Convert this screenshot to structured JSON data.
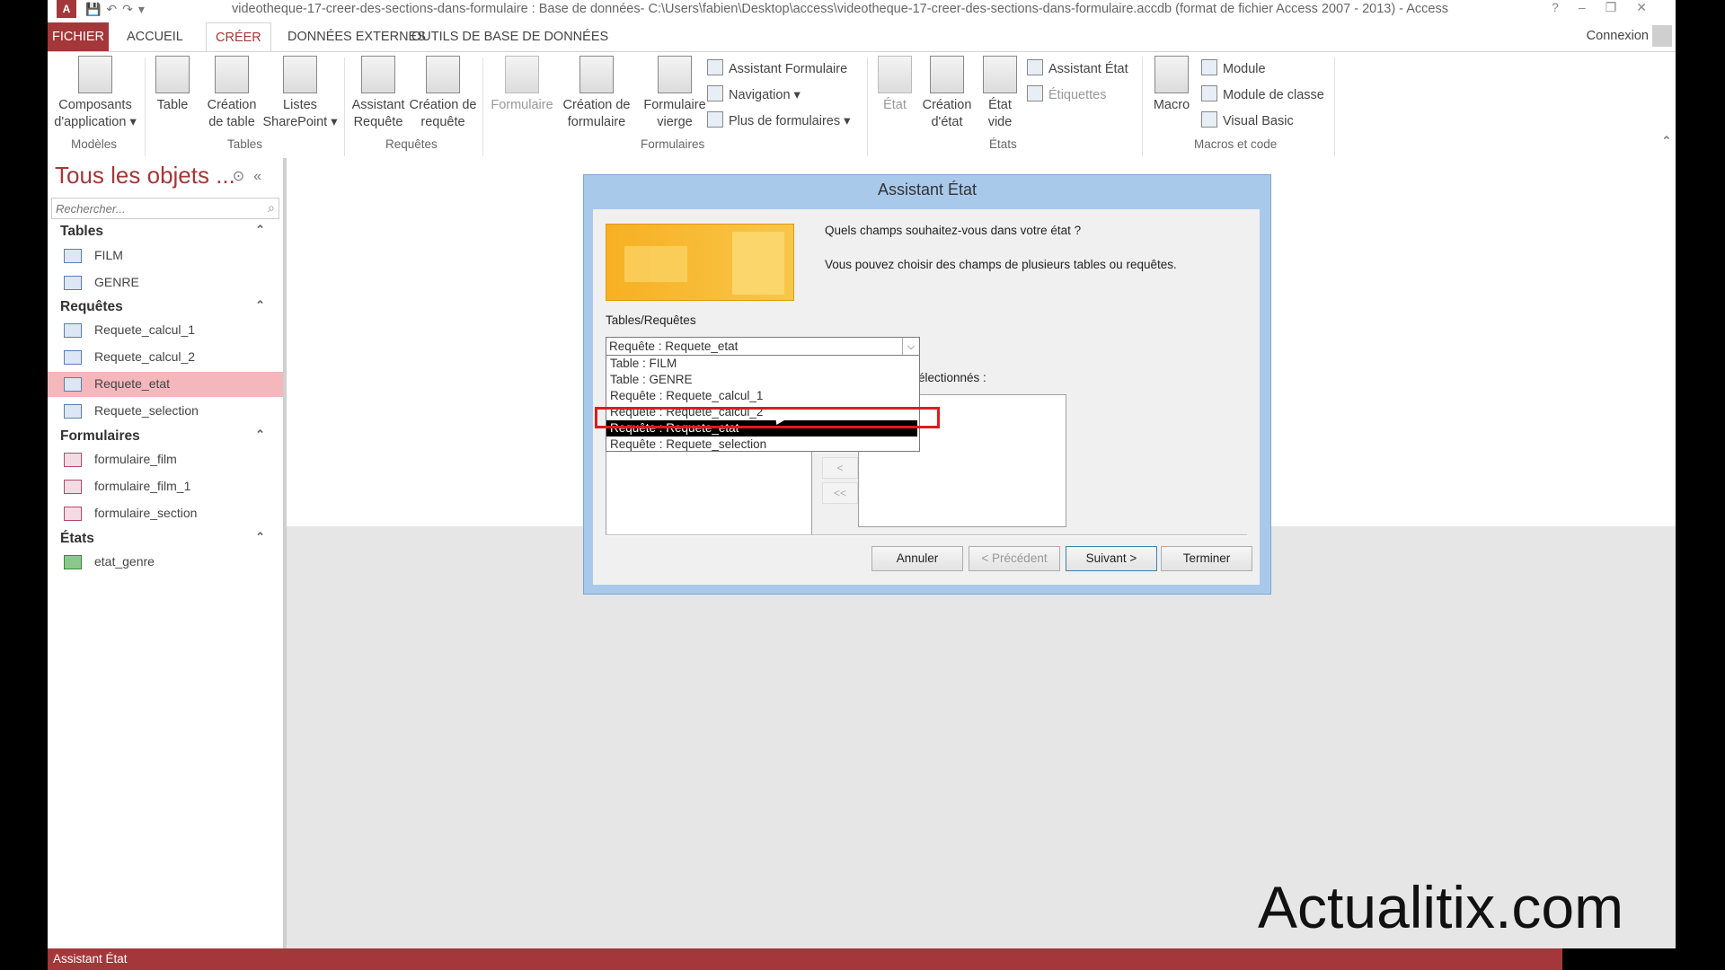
{
  "window": {
    "app_logo": "A",
    "title": "videotheque-17-creer-des-sections-dans-formulaire : Base de données- C:\\Users\\fabien\\Desktop\\access\\videotheque-17-creer-des-sections-dans-formulaire.accdb (format de fichier Access 2007 - 2013) - Access"
  },
  "tabs": [
    "FICHIER",
    "ACCUEIL",
    "CRÉER",
    "DONNÉES EXTERNES",
    "OUTILS DE BASE DE DONNÉES"
  ],
  "connexion": "Connexion",
  "ribbon": {
    "modeles": {
      "btn": "Composants d'application",
      "group": "Modèles"
    },
    "tables": {
      "table": "Table",
      "creation_table": "Création de table",
      "listes": "Listes SharePoint",
      "group": "Tables"
    },
    "requetes": {
      "assistant": "Assistant Requête",
      "creation": "Création de requête",
      "group": "Requêtes"
    },
    "formulaires": {
      "formulaire": "Formulaire",
      "creation": "Création de formulaire",
      "vierge": "Formulaire vierge",
      "assistant": "Assistant Formulaire",
      "navigation": "Navigation",
      "plus": "Plus de formulaires",
      "group": "Formulaires"
    },
    "etats": {
      "etat": "État",
      "creation": "Création d'état",
      "vide": "État vide",
      "assistant": "Assistant État",
      "etiquettes": "Étiquettes",
      "group": "États"
    },
    "macros": {
      "macro": "Macro",
      "module": "Module",
      "module_classe": "Module de classe",
      "vb": "Visual Basic",
      "group": "Macros et code"
    }
  },
  "nav": {
    "title": "Tous les objets ...",
    "search_placeholder": "Rechercher...",
    "sections": {
      "tables": {
        "label": "Tables",
        "items": [
          "FILM",
          "GENRE"
        ]
      },
      "requetes": {
        "label": "Requêtes",
        "items": [
          "Requete_calcul_1",
          "Requete_calcul_2",
          "Requete_etat",
          "Requete_selection"
        ]
      },
      "formulaires": {
        "label": "Formulaires",
        "items": [
          "formulaire_film",
          "formulaire_film_1",
          "formulaire_section"
        ]
      },
      "etats": {
        "label": "États",
        "items": [
          "etat_genre"
        ]
      }
    }
  },
  "dialog": {
    "title": "Assistant État",
    "question": "Quels champs souhaitez-vous dans votre état ?",
    "hint": "Vous pouvez choisir des champs de plusieurs tables ou requêtes.",
    "tables_label": "Tables/Requêtes",
    "combo_value": "Requête : Requete_etat",
    "selected_label": "électionnés :",
    "options": [
      "Table : FILM",
      "Table : GENRE",
      "Requête : Requete_calcul_1",
      "Requête : Requete_calcul_2",
      "Requête : Requete_etat",
      "Requête : Requete_selection"
    ],
    "move_back": "<",
    "move_all_back": "<<",
    "buttons": {
      "cancel": "Annuler",
      "prev": "< Précédent",
      "next": "Suivant >",
      "finish": "Terminer"
    }
  },
  "status": "Assistant État",
  "watermark": "Actualitix.com"
}
